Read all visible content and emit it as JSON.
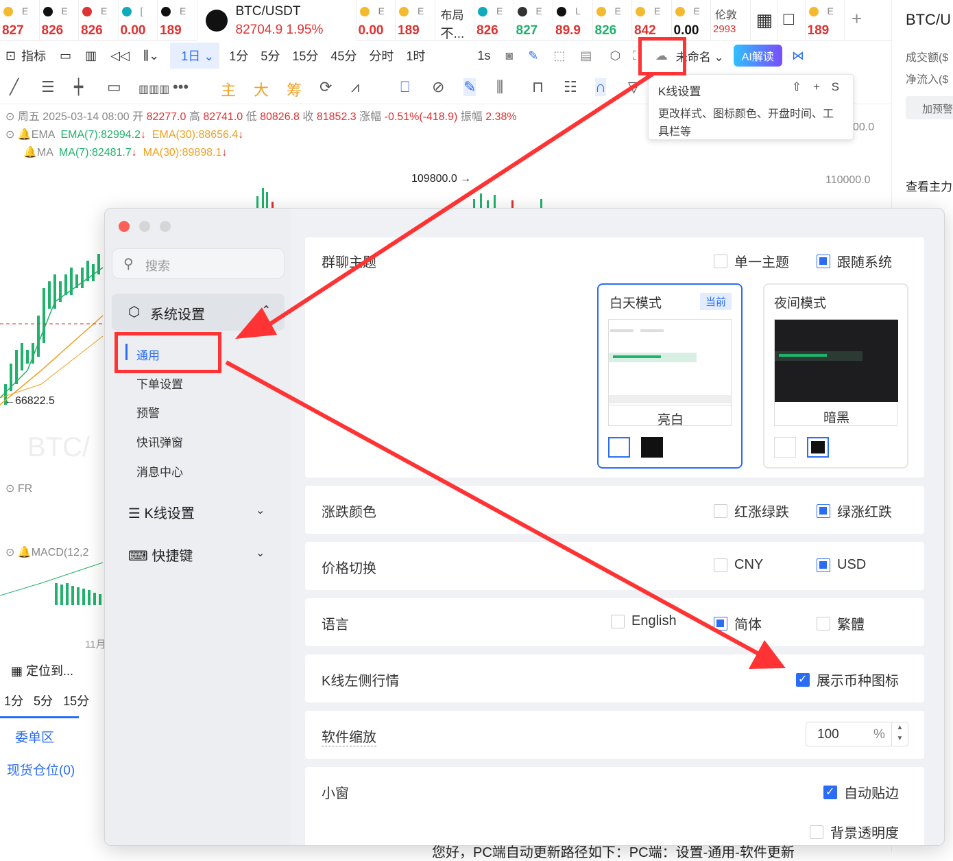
{
  "ticker_tabs": [
    {
      "label": "E",
      "price": "827",
      "dir": "up"
    },
    {
      "label": "E",
      "price": "826",
      "dir": "up"
    },
    {
      "label": "E",
      "price": "826",
      "dir": "up"
    },
    {
      "label": "[",
      "price": "0.00",
      "dir": "up"
    },
    {
      "label": "E",
      "price": "189",
      "dir": "up"
    }
  ],
  "active_tab": {
    "symbol": "BTC/USDT",
    "price": "82704.9",
    "change": "1.95%"
  },
  "ticker_tabs_right": [
    {
      "label": "E",
      "price": "0.00",
      "dir": "up"
    },
    {
      "label": "E",
      "price": "189",
      "dir": "up"
    },
    {
      "label": "布局",
      "price": "不...",
      "dir": "none"
    },
    {
      "label": "E",
      "price": "826",
      "dir": "up"
    },
    {
      "label": "E",
      "price": "827",
      "dir": "dn"
    },
    {
      "label": "L",
      "price": "89.9",
      "dir": "up"
    },
    {
      "label": "E",
      "price": "826",
      "dir": "dn"
    },
    {
      "label": "E",
      "price": "842",
      "dir": "up"
    },
    {
      "label": "E",
      "price": "0.00",
      "dir": "none"
    },
    {
      "label": "伦敦",
      "price": "2993",
      "dir": "up"
    }
  ],
  "toolbar1": {
    "indicators": "指标",
    "interval_1d": "1日",
    "intervals": [
      "1分",
      "5分",
      "15分",
      "45分",
      "分时",
      "1时"
    ],
    "interval_1s": "1s",
    "layout_name": "未命名",
    "ai": "AI解读"
  },
  "toolbar2_labels": [
    "主",
    "大",
    "筹"
  ],
  "chart_info": {
    "date": "周五 2025-03-14 08:00",
    "open_label": "开",
    "open": "82277.0",
    "high_label": "高",
    "high": "82741.0",
    "low_label": "低",
    "low": "80826.8",
    "close_label": "收",
    "close": "81852.3",
    "chg_label": "涨幅",
    "chg": "-0.51%(-418.9)",
    "amp_label": "振幅",
    "amp": "2.38%",
    "ema_name": "EMA",
    "ema7": "EMA(7):82994.2",
    "ema30": "EMA(30):88656.4",
    "ma_name": "MA",
    "ma7": "MA(7):82481.7",
    "ma30": "MA(30):89898.1",
    "price_marker_high": "109800.0 →",
    "price_marker_low": "←66822.5",
    "axis_110000": "110000.0",
    "axis_top": "00.0",
    "fr": "FR",
    "macd": "MACD(12,2",
    "watermark": "BTC/",
    "month": "11月"
  },
  "tooltip": {
    "title": "K线设置",
    "shortcut": "⇧ + S",
    "desc": "更改样式、图标颜色、开盘时间、工具栏等"
  },
  "bottom_left": {
    "locate": "定位到...",
    "intervals": [
      "1分",
      "5分",
      "15分"
    ],
    "orders": "委单区",
    "position": "现货仓位(0)"
  },
  "right_panel": {
    "title": "BTC/U",
    "vol": "成交额($",
    "inflow": "净流入($",
    "alert": "加预警",
    "view": "查看主力"
  },
  "dialog": {
    "search_placeholder": "搜索",
    "section_system": "系统设置",
    "sub_items": [
      "通用",
      "下单设置",
      "预警",
      "快讯弹窗",
      "消息中心"
    ],
    "section_kline": "K线设置",
    "section_hotkey": "快捷键",
    "theme": {
      "label": "群聊主题",
      "opt1": "单一主题",
      "opt2": "跟随系统",
      "day": "白天模式",
      "current": "当前",
      "day_name": "亮白",
      "night": "夜间模式",
      "night_name": "暗黑"
    },
    "color": {
      "label": "涨跌颜色",
      "opt1": "红涨绿跌",
      "opt2": "绿涨红跌"
    },
    "price": {
      "label": "价格切换",
      "opt1": "CNY",
      "opt2": "USD"
    },
    "lang": {
      "label": "语言",
      "opt1": "English",
      "opt2": "简体",
      "opt3": "繁體"
    },
    "kleft": {
      "label": "K线左侧行情",
      "opt1": "展示币种图标"
    },
    "zoom": {
      "label": "软件缩放",
      "value": "100",
      "unit": "%"
    },
    "mini": {
      "label": "小窗",
      "opt1": "自动贴边",
      "opt2": "背景透明度"
    }
  },
  "bottom_text": "您好，PC端自动更新路径如下：PC端：设置-通用-软件更新"
}
